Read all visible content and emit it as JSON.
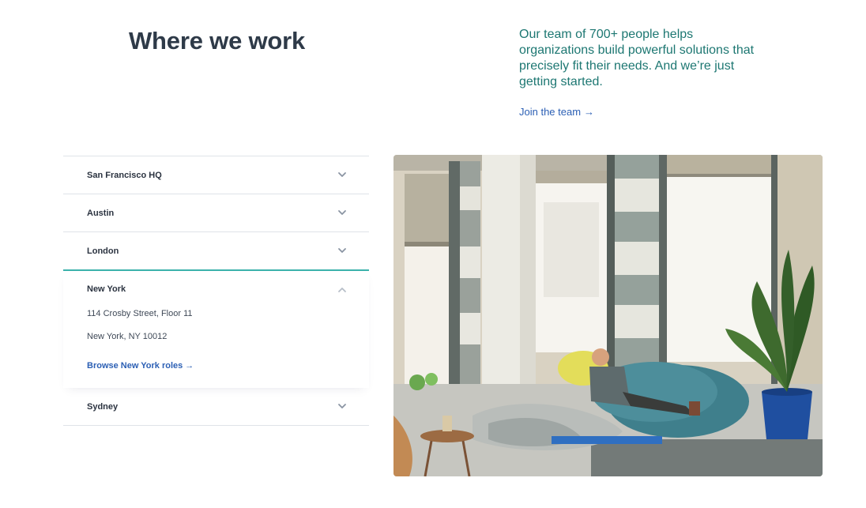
{
  "header": {
    "title": "Where we work",
    "intro": "Our team of 700+ people helps organizations build powerful solutions that precisely fit their needs. And we’re just getting started.",
    "join_label": "Join the team",
    "arrow": "→"
  },
  "locations": {
    "items": [
      {
        "label": "San Francisco HQ",
        "icon": "chevron-down-icon"
      },
      {
        "label": "Austin",
        "icon": "chevron-down-icon"
      },
      {
        "label": "London",
        "icon": "chevron-down-icon"
      },
      {
        "label": "New York",
        "icon": "chevron-up-icon"
      },
      {
        "label": "Sydney",
        "icon": "chevron-down-icon"
      }
    ],
    "open": {
      "address_line1": "114 Crosby Street, Floor 11",
      "address_line2": "New York, NY 10012",
      "browse_label": "Browse New York roles"
    }
  },
  "colors": {
    "accent_teal": "#3bb2ab",
    "intro_text": "#1d7772",
    "link_blue": "#2b5fb4"
  }
}
